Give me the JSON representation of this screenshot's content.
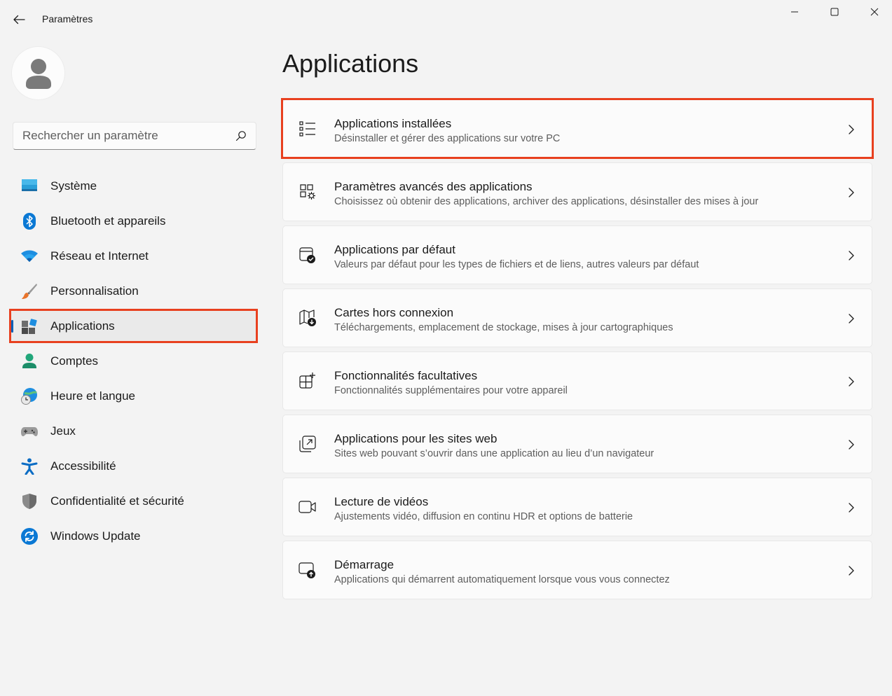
{
  "window": {
    "title": "Paramètres"
  },
  "search": {
    "placeholder": "Rechercher un paramètre"
  },
  "sidebar": {
    "items": [
      {
        "label": "Système",
        "icon": "monitor-icon"
      },
      {
        "label": "Bluetooth et appareils",
        "icon": "bluetooth-icon"
      },
      {
        "label": "Réseau et Internet",
        "icon": "wifi-icon"
      },
      {
        "label": "Personnalisation",
        "icon": "brush-icon"
      },
      {
        "label": "Applications",
        "icon": "apps-icon",
        "selected": true
      },
      {
        "label": "Comptes",
        "icon": "person-icon"
      },
      {
        "label": "Heure et langue",
        "icon": "globe-clock-icon"
      },
      {
        "label": "Jeux",
        "icon": "gamepad-icon"
      },
      {
        "label": "Accessibilité",
        "icon": "accessibility-icon"
      },
      {
        "label": "Confidentialité et sécurité",
        "icon": "shield-icon"
      },
      {
        "label": "Windows Update",
        "icon": "update-icon"
      }
    ]
  },
  "main": {
    "title": "Applications",
    "cards": [
      {
        "title": "Applications installées",
        "description": "Désinstaller et gérer des applications sur votre PC",
        "icon": "list-icon"
      },
      {
        "title": "Paramètres avancés des applications",
        "description": "Choisissez où obtenir des applications, archiver des applications, désinstaller des mises à jour",
        "icon": "app-settings-icon"
      },
      {
        "title": "Applications par défaut",
        "description": "Valeurs par défaut pour les types de fichiers et de liens, autres valeurs par défaut",
        "icon": "default-apps-icon"
      },
      {
        "title": "Cartes hors connexion",
        "description": "Téléchargements, emplacement de stockage, mises à jour cartographiques",
        "icon": "map-download-icon"
      },
      {
        "title": "Fonctionnalités facultatives",
        "description": "Fonctionnalités supplémentaires pour votre appareil",
        "icon": "add-feature-icon"
      },
      {
        "title": "Applications pour les sites web",
        "description": "Sites web pouvant s’ouvrir dans une application au lieu d’un navigateur",
        "icon": "open-external-icon"
      },
      {
        "title": "Lecture de vidéos",
        "description": "Ajustements vidéo, diffusion en continu HDR et options de batterie",
        "icon": "video-camera-icon"
      },
      {
        "title": "Démarrage",
        "description": "Applications qui démarrent automatiquement lorsque vous vous connectez",
        "icon": "startup-icon"
      }
    ]
  },
  "colors": {
    "accent": "#005fb8",
    "highlight": "#e8401f",
    "background": "#f3f3f3"
  }
}
